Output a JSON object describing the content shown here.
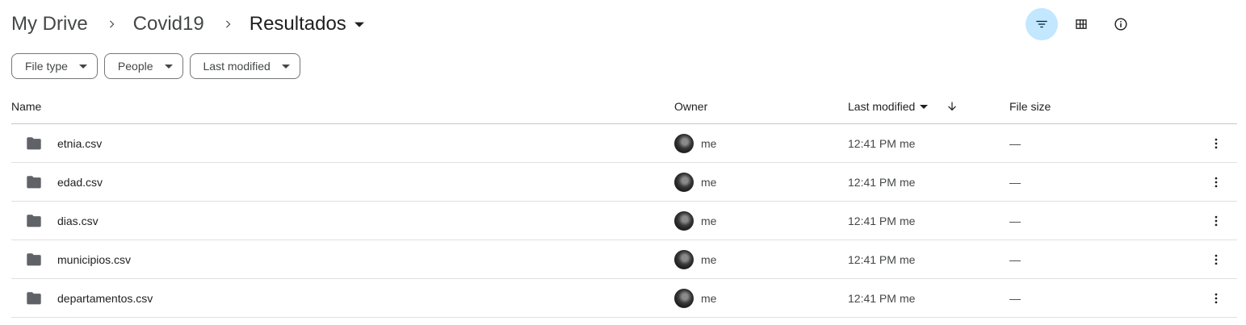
{
  "breadcrumb": {
    "items": [
      {
        "label": "My Drive"
      },
      {
        "label": "Covid19"
      },
      {
        "label": "Resultados"
      }
    ]
  },
  "filters": [
    {
      "label": "File type"
    },
    {
      "label": "People"
    },
    {
      "label": "Last modified"
    }
  ],
  "columns": {
    "name": "Name",
    "owner": "Owner",
    "last_modified": "Last modified",
    "file_size": "File size"
  },
  "files": [
    {
      "name": "etnia.csv",
      "owner": "me",
      "modified_time": "12:41 PM",
      "modified_by": "me",
      "size": "—"
    },
    {
      "name": "edad.csv",
      "owner": "me",
      "modified_time": "12:41 PM",
      "modified_by": "me",
      "size": "—"
    },
    {
      "name": "dias.csv",
      "owner": "me",
      "modified_time": "12:41 PM",
      "modified_by": "me",
      "size": "—"
    },
    {
      "name": "municipios.csv",
      "owner": "me",
      "modified_time": "12:41 PM",
      "modified_by": "me",
      "size": "—"
    },
    {
      "name": "departamentos.csv",
      "owner": "me",
      "modified_time": "12:41 PM",
      "modified_by": "me",
      "size": "—"
    }
  ],
  "icons": {
    "filter": "filter-icon",
    "grid": "grid-view-icon",
    "info": "info-icon",
    "folder": "folder-icon",
    "more": "more-vert-icon"
  },
  "colors": {
    "active_button": "#c2e7ff",
    "folder": "#5f6368"
  }
}
